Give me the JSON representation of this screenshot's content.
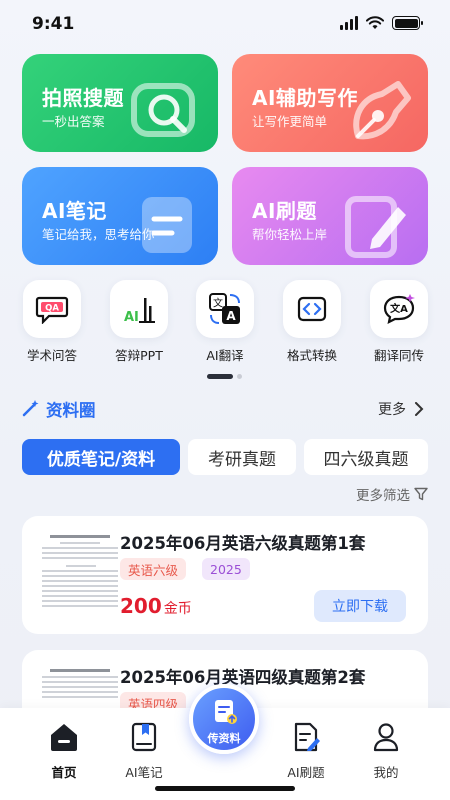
{
  "status": {
    "time": "9:41"
  },
  "cards": [
    {
      "title": "拍照搜题",
      "subtitle": "一秒出答案",
      "icon": "camera-search-icon",
      "colors": [
        "#34d27a",
        "#17b866"
      ]
    },
    {
      "title": "AI辅助写作",
      "subtitle": "让写作更简单",
      "icon": "pen-nib-icon",
      "colors": [
        "#ff8b7a",
        "#f56762"
      ]
    },
    {
      "title": "AI笔记",
      "subtitle": "笔记给我，思考给你",
      "icon": "note-icon",
      "colors": [
        "#4fa3ff",
        "#2d7ff4"
      ]
    },
    {
      "title": "AI刷题",
      "subtitle": "帮你轻松上岸",
      "icon": "pencil-paper-icon",
      "colors": [
        "#e88af0",
        "#b86ef1"
      ]
    }
  ],
  "tools": [
    {
      "label": "学术问答",
      "icon": "qa-bubble-icon"
    },
    {
      "label": "答辩PPT",
      "icon": "ppt-chart-icon"
    },
    {
      "label": "AI翻译",
      "icon": "translate-icon"
    },
    {
      "label": "格式转换",
      "icon": "code-convert-icon"
    },
    {
      "label": "翻译同传",
      "icon": "chat-translate-icon"
    }
  ],
  "section": {
    "title": "资料圈",
    "more": "更多"
  },
  "tabs": [
    "优质笔记/资料",
    "考研真题",
    "四六级真题"
  ],
  "filter": "更多筛选",
  "items": [
    {
      "title": "2025年06月英语六级真题第1套",
      "tags": [
        "英语六级",
        "2025"
      ],
      "price": "200",
      "unit": "金币",
      "action": "立即下载"
    },
    {
      "title": "2025年06月英语四级真题第2套",
      "tags": [
        "英语四级"
      ]
    }
  ],
  "nav": [
    {
      "label": "首页",
      "icon": "home-icon",
      "active": true
    },
    {
      "label": "AI笔记",
      "icon": "notebook-icon"
    },
    {
      "label": "AI刷题",
      "icon": "quiz-icon"
    },
    {
      "label": "我的",
      "icon": "user-icon"
    }
  ],
  "fab": {
    "label": "传资料",
    "icon": "upload-doc-icon"
  },
  "accent": "#2d6ff2"
}
